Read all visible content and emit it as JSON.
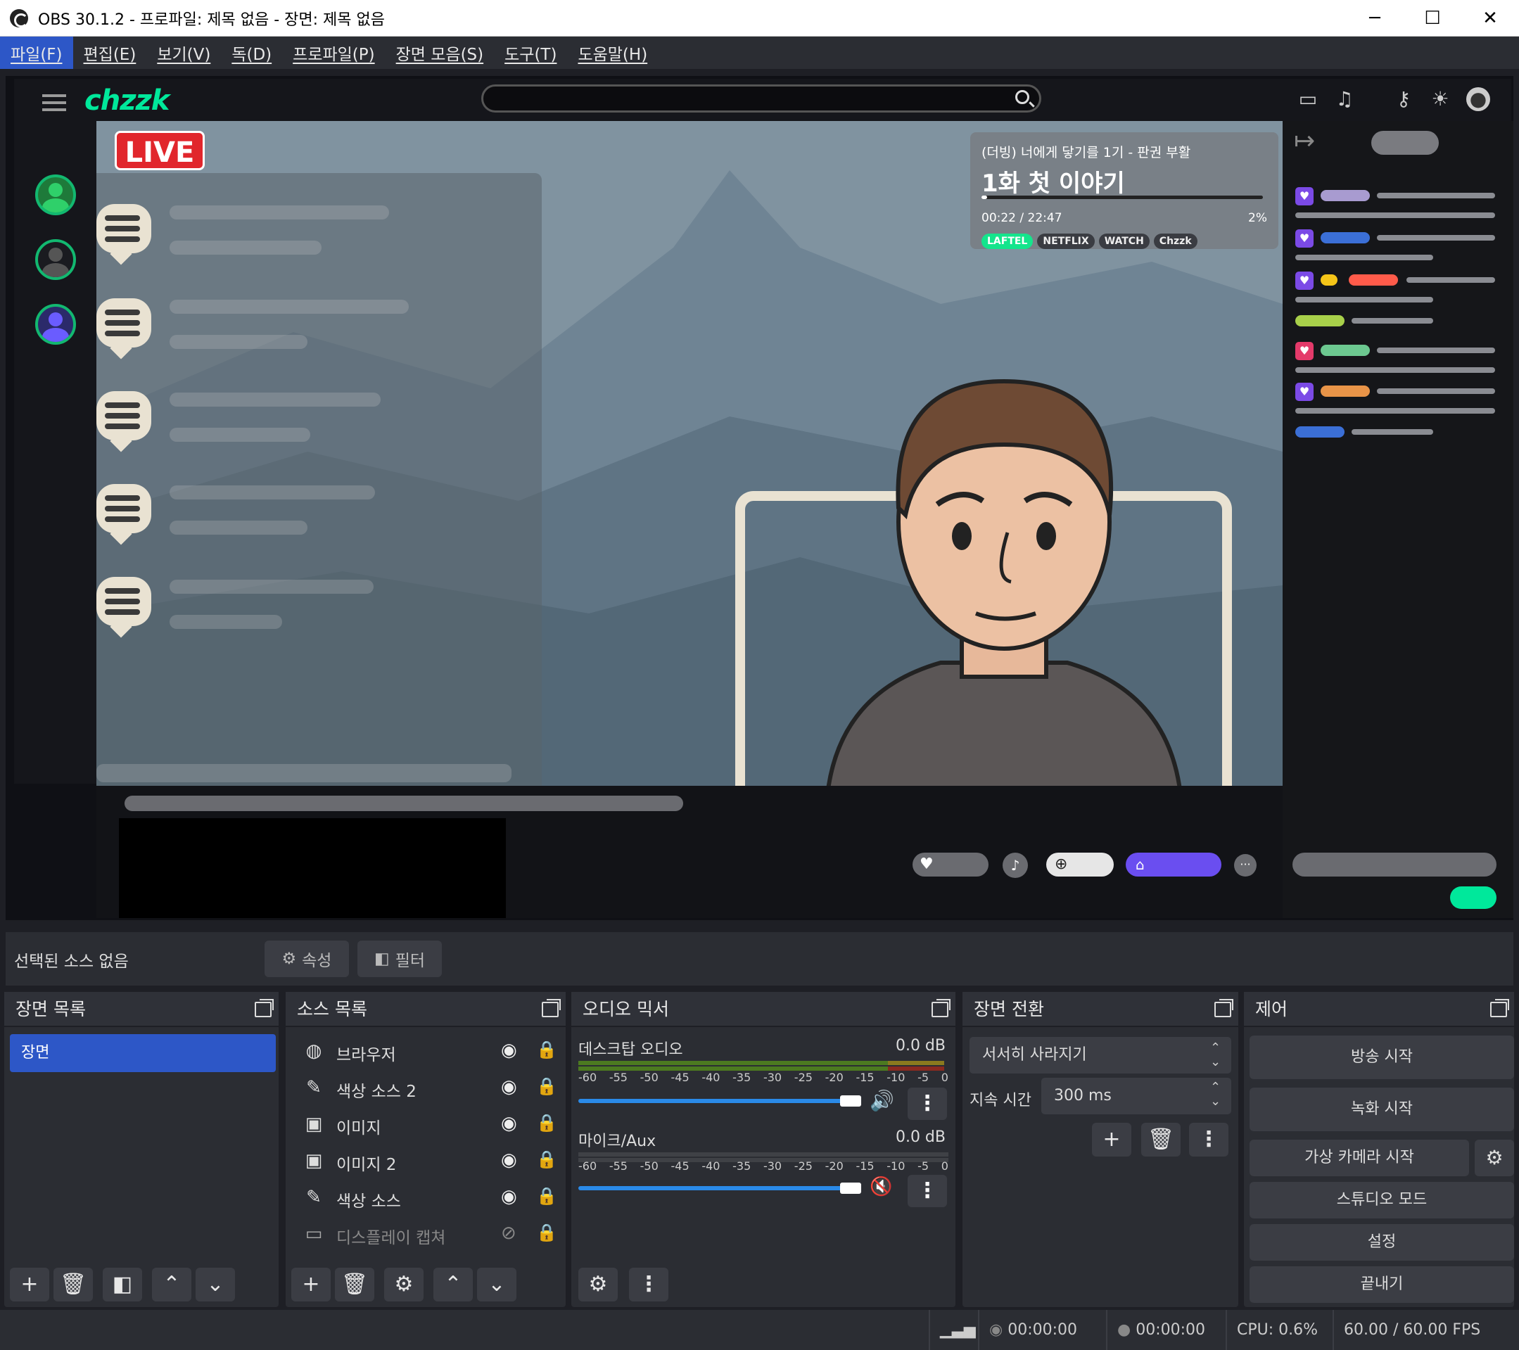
{
  "window": {
    "title": "OBS 30.1.2 - 프로파일: 제목 없음 - 장면: 제목 없음",
    "minimize": "─",
    "maximize": "☐",
    "close": "✕"
  },
  "menu": [
    "파일(F)",
    "편집(E)",
    "보기(V)",
    "독(D)",
    "프로파일(P)",
    "장면 모음(S)",
    "도구(T)",
    "도움말(H)"
  ],
  "preview": {
    "brand": "chzzk",
    "live_badge": "LIVE",
    "overlay": {
      "subtitle": "(더빙) 너에게 닿기를 1기 - 판권 부활",
      "title": "1화 첫 이야기",
      "time": "00:22 / 22:47",
      "percent": "2%",
      "progress": 0.02,
      "tags": [
        "LAFTEL",
        "NETFLIX",
        "WATCH",
        "Chzzk"
      ]
    },
    "colors": {
      "brand": "#00e89b",
      "live": "#e1262c",
      "accent": "#6a4ef0"
    }
  },
  "properties_bar": {
    "no_source": "선택된 소스 없음",
    "properties": "속성",
    "filters": "필터"
  },
  "scenes": {
    "title": "장면 목록",
    "items": [
      "장면"
    ]
  },
  "sources": {
    "title": "소스 목록",
    "items": [
      {
        "name": "브라우저",
        "icon": "globe-icon"
      },
      {
        "name": "색상 소스 2",
        "icon": "brush-icon"
      },
      {
        "name": "이미지",
        "icon": "image-icon"
      },
      {
        "name": "이미지 2",
        "icon": "image-icon"
      },
      {
        "name": "색상 소스",
        "icon": "brush-icon"
      },
      {
        "name": "디스플레이 캡쳐",
        "icon": "monitor-icon",
        "hidden": true
      }
    ]
  },
  "mixer": {
    "title": "오디오 믹서",
    "channels": [
      {
        "name": "데스크탑 오디오",
        "db": "0.0 dB",
        "muted": false
      },
      {
        "name": "마이크/Aux",
        "db": "0.0 dB",
        "muted": true
      }
    ],
    "ticks": [
      "-60",
      "-55",
      "-50",
      "-45",
      "-40",
      "-35",
      "-30",
      "-25",
      "-20",
      "-15",
      "-10",
      "-5",
      "0"
    ]
  },
  "transitions": {
    "title": "장면 전환",
    "selected": "서서히 사라지기",
    "duration_label": "지속 시간",
    "duration_value": "300 ms"
  },
  "controls": {
    "title": "제어",
    "buttons": [
      "방송 시작",
      "녹화 시작",
      "가상 카메라 시작",
      "스튜디오 모드",
      "설정",
      "끝내기"
    ]
  },
  "status": {
    "stream_time": "00:00:00",
    "record_time": "00:00:00",
    "cpu": "CPU: 0.6%",
    "fps": "60.00 / 60.00 FPS"
  }
}
